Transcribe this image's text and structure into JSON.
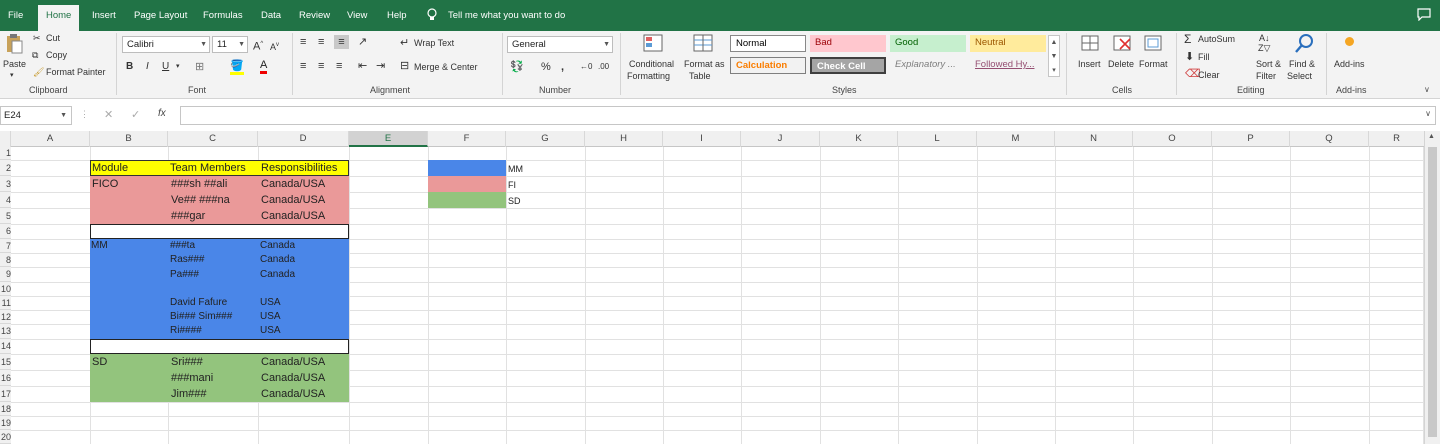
{
  "menu": {
    "tabs": [
      "File",
      "Home",
      "Insert",
      "Page Layout",
      "Formulas",
      "Data",
      "Review",
      "View",
      "Help"
    ],
    "active_tab": "Home",
    "tell_me": "Tell me what you want to do"
  },
  "ribbon": {
    "clipboard": {
      "paste": "Paste",
      "cut": "Cut",
      "copy": "Copy",
      "format_painter": "Format Painter",
      "group": "Clipboard"
    },
    "font": {
      "name": "Calibri",
      "size": "11",
      "bold": "B",
      "italic": "I",
      "underline": "U",
      "group": "Font"
    },
    "alignment": {
      "wrap_text": "Wrap Text",
      "merge_center": "Merge & Center",
      "group": "Alignment"
    },
    "number": {
      "format": "General",
      "percent": "%",
      "comma": ",",
      "group": "Number"
    },
    "styles": {
      "conditional_formatting_1": "Conditional",
      "conditional_formatting_2": "Formatting",
      "format_as_table_1": "Format as",
      "format_as_table_2": "Table",
      "normal": "Normal",
      "bad": "Bad",
      "good": "Good",
      "neutral": "Neutral",
      "calculation": "Calculation",
      "check_cell": "Check Cell",
      "explanatory": "Explanatory ...",
      "followed": "Followed Hy...",
      "group": "Styles"
    },
    "cells": {
      "insert": "Insert",
      "delete": "Delete",
      "format": "Format",
      "group": "Cells"
    },
    "editing": {
      "autosum": "AutoSum",
      "fill": "Fill",
      "clear": "Clear",
      "sort_1": "Sort &",
      "sort_2": "Filter",
      "find_1": "Find &",
      "find_2": "Select",
      "group": "Editing"
    },
    "addins": {
      "label": "Add-ins",
      "group": "Add-ins"
    }
  },
  "formula_bar": {
    "name_box": "E24",
    "fx": "fx",
    "value": ""
  },
  "grid": {
    "columns": [
      "A",
      "B",
      "C",
      "D",
      "E",
      "F",
      "G",
      "H",
      "I",
      "J",
      "K",
      "L",
      "M",
      "N",
      "O",
      "P",
      "Q",
      "R"
    ],
    "selected_column": "E",
    "rows": [
      "1",
      "2",
      "3",
      "4",
      "5",
      "6",
      "7",
      "8",
      "9",
      "10",
      "11",
      "12",
      "13",
      "14",
      "15",
      "16",
      "17",
      "18",
      "19",
      "20"
    ],
    "header": {
      "module": "Module",
      "team": "Team Members",
      "resp": "Responsibilities"
    },
    "fico": {
      "module": "FICO",
      "members": [
        "###sh ##ali",
        "Ve## ###na",
        "###gar"
      ],
      "resp": [
        "Canada/USA",
        "Canada/USA",
        "Canada/USA"
      ]
    },
    "mm": {
      "module": "MM",
      "members": [
        "###ta",
        "Ras###",
        "Pa###",
        "David Fafure",
        "Bi### Sim###",
        "Ri####"
      ],
      "resp": [
        "Canada",
        "Canada",
        "Canada",
        "USA",
        "USA",
        "USA"
      ]
    },
    "sd": {
      "module": "SD",
      "members": [
        "Sri###",
        "###mani",
        "Jim###"
      ],
      "resp": [
        "Canada/USA",
        "Canada/USA",
        "Canada/USA"
      ]
    },
    "legend": [
      "MM",
      "FI",
      "SD"
    ]
  },
  "colors": {
    "excel_green": "#217346",
    "yellow": "#ffff00",
    "fico_pink": "#ea9999",
    "mm_blue": "#4a86e8",
    "sd_green": "#93c47d"
  }
}
